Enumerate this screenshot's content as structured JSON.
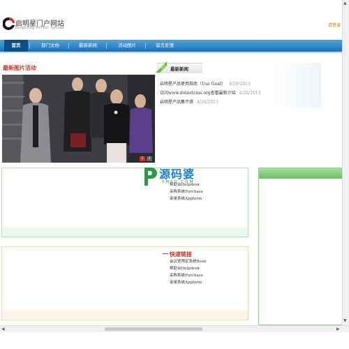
{
  "header": {
    "site_title": "启明星门户网站",
    "site_subtitle": "Dingjuing Portal System",
    "login_link": "请登录"
  },
  "nav": {
    "items": [
      {
        "label": "首页",
        "active": true
      },
      {
        "label": "部门文档",
        "active": false
      },
      {
        "label": "最新新闻",
        "active": false
      },
      {
        "label": "活动图片",
        "active": false
      },
      {
        "label": "留言反馈",
        "active": false
      }
    ]
  },
  "photos": {
    "title": "最新图片活动",
    "pages": [
      "1",
      "2"
    ],
    "current_page": "1"
  },
  "news": {
    "badge": "NEW",
    "title": "最新新闻",
    "items": [
      {
        "title": "启明星产品使用指南（Use Guid）",
        "date": "4/26/2013"
      },
      {
        "title": "访问www.dotnetcms.org查看最新介绍",
        "date": "4/26/2013"
      },
      {
        "title": "启明星产品集不错",
        "date": "4/26/2013"
      }
    ]
  },
  "systems_list": {
    "items": [
      "帮助台Helpdesk",
      "采购系统Purchase",
      "审单系统Appform"
    ]
  },
  "quick_links": {
    "title": "快速链接",
    "items": [
      "会议室预定系统Book",
      "帮助台Helpdesk",
      "采购系统Purchase",
      "审单系统Appform"
    ]
  },
  "watermark": {
    "text": "源码婆",
    "sub": "YMPO.COM"
  },
  "colors": {
    "nav_top": "#4fa3dc",
    "nav_bottom": "#1e6fb5",
    "nav_active": "#0b4f86",
    "section_red": "#c0392b",
    "panel_green": "#8fcf8a",
    "panel_orange": "#f2d9b3",
    "login_orange": "#c08000"
  }
}
